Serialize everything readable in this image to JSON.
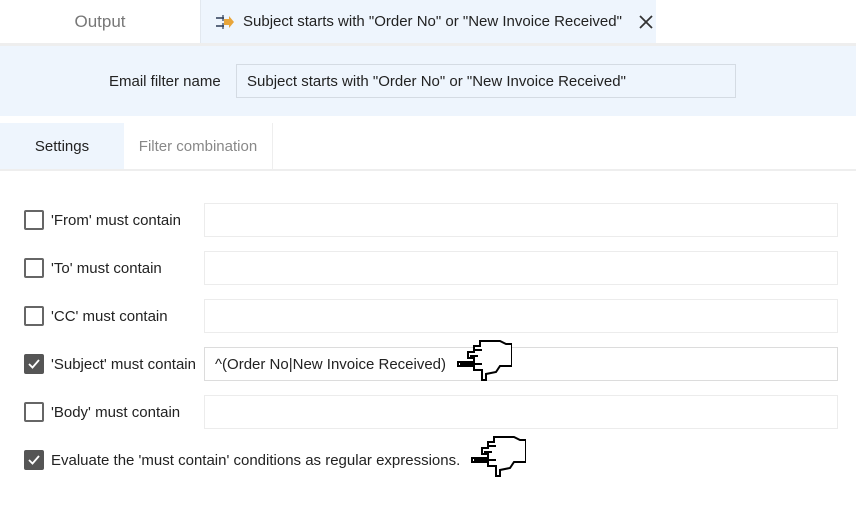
{
  "tabs": {
    "output": "Output",
    "active": {
      "icon": "filter-arrow-icon",
      "title": "Subject starts with \"Order No\" or \"New Invoice Received\"",
      "close_icon": "close-icon"
    }
  },
  "name_panel": {
    "label": "Email filter name",
    "value": "Subject starts with \"Order No\" or \"New Invoice Received\""
  },
  "subtabs": [
    {
      "label": "Settings",
      "active": true
    },
    {
      "label": "Filter combination",
      "active": false
    }
  ],
  "rows": [
    {
      "label": "'From' must contain",
      "checked": false,
      "value": ""
    },
    {
      "label": "'To' must contain",
      "checked": false,
      "value": ""
    },
    {
      "label": "'CC' must contain",
      "checked": false,
      "value": ""
    },
    {
      "label": "'Subject' must contain",
      "checked": true,
      "value": "^(Order No|New Invoice Received)"
    },
    {
      "label": "'Body' must contain",
      "checked": false,
      "value": ""
    }
  ],
  "regex_option": {
    "label": "Evaluate the 'must contain' conditions as regular expressions.",
    "checked": true
  },
  "annotations": [
    "pointing-hand-icon",
    "pointing-hand-icon"
  ],
  "colors": {
    "panel_bg": "#eef5fd",
    "checkbox_checked": "#555555"
  }
}
